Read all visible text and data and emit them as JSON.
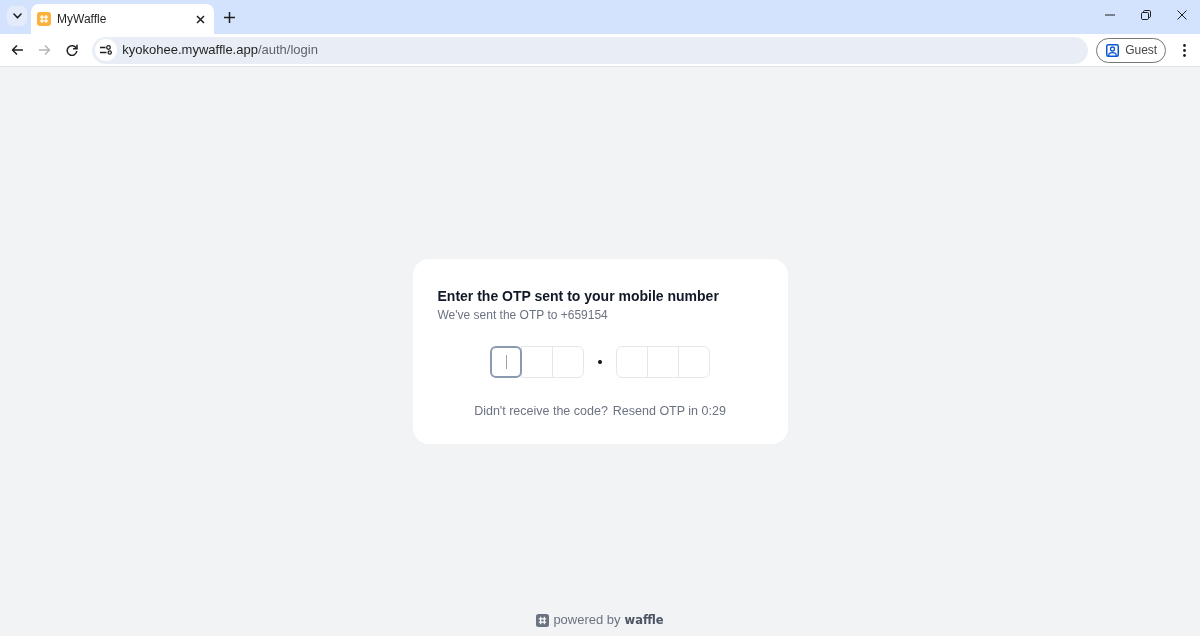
{
  "browser": {
    "tabs": [
      {
        "title": "MyWaffle",
        "selected": true
      }
    ],
    "nav_buttons": [
      {
        "kind": "back",
        "disabled": false
      },
      {
        "kind": "forward",
        "disabled": true
      },
      {
        "kind": "reload",
        "disabled": false
      }
    ],
    "address": {
      "host": "kyokohee.mywaffle.app",
      "path": "/auth/login"
    },
    "profile": {
      "label": "Guest"
    }
  },
  "otp_card": {
    "title": "Enter the OTP sent to your mobile number",
    "subtitle": "We've sent the OTP to +659154",
    "digit_groups": [
      {
        "cells": [
          {
            "focused": true
          },
          {
            "focused": false
          },
          {
            "focused": false
          }
        ]
      },
      {
        "cells": [
          {
            "focused": false
          },
          {
            "focused": false
          },
          {
            "focused": false
          }
        ]
      }
    ],
    "resend_prompt": "Didn't receive the code?",
    "resend_countdown": "Resend OTP in 0:29"
  },
  "footer": {
    "prefix": "powered by",
    "brand": "waffle"
  }
}
